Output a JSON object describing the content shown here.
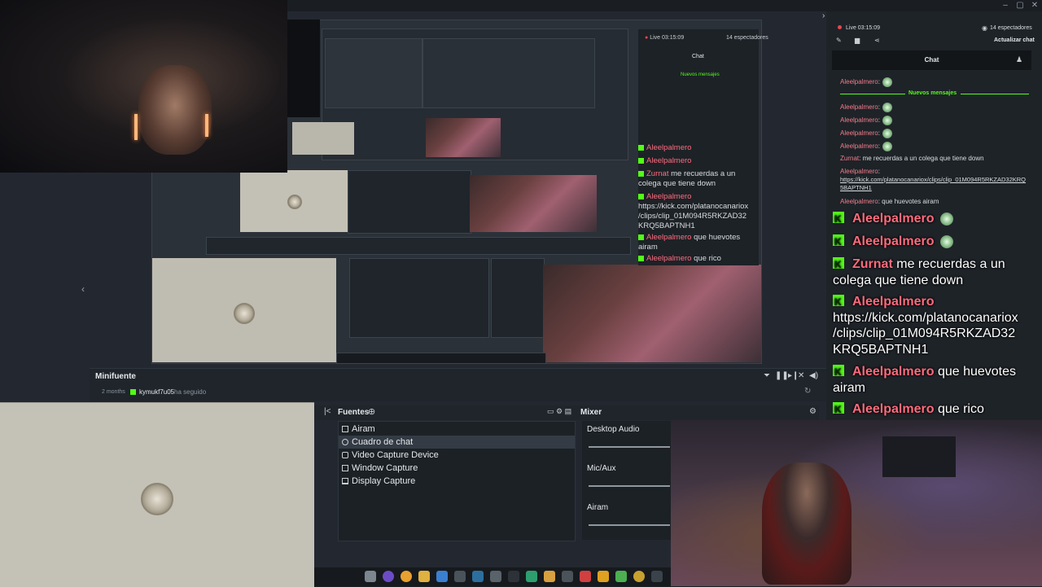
{
  "stream": {
    "live_label": "Live 03:15:09",
    "viewers_label": "14 espectadores",
    "update_chat_label": "Actualizar chat",
    "chat_title": "Chat",
    "new_messages_label": "Nuevos mensajes"
  },
  "chat_small": [
    {
      "user": "Aleelpalmero",
      "text": ":",
      "emote": true
    },
    {
      "user": "Aleelpalmero",
      "text": ":",
      "emote": true
    },
    {
      "user": "Aleelpalmero",
      "text": ":",
      "emote": true
    },
    {
      "user": "Aleelpalmero",
      "text": ":",
      "emote": true
    },
    {
      "user": "Aleelpalmero",
      "text": ":",
      "emote": true
    },
    {
      "user": "Zurnat",
      "text": ": me recuerdas a un colega que tiene down",
      "emote": false
    },
    {
      "user": "Aleelpalmero",
      "text": ":",
      "emote": false
    },
    {
      "user": "",
      "text": "https://kick.com/platanocanariox/clips/clip_01M094R5RKZAD32KRQ",
      "emote": false
    },
    {
      "user": "",
      "text": "5BAPTNH1",
      "emote": false
    },
    {
      "user": "Aleelpalmero",
      "text": ": que huevotes airam",
      "emote": false
    }
  ],
  "chat_big": {
    "line1_user": "Aleelpalmero",
    "line2_user": "Aleelpalmero",
    "line3_user": "Zurnat",
    "line3_text": "me recuerdas a un",
    "line3b_text": "colega que tiene down",
    "line4_user": "Aleelpalmero",
    "line5_text": "https://kick.com/platanocanariox",
    "line6_text": "/clips/clip_01M094R5RKZAD32",
    "line7_text": "KRQ5BAPTNH1",
    "line8_user": "Aleelpalmero",
    "line8_text": "que huevotes",
    "line8b_text": "airam",
    "line9_user": "Aleelpalmero",
    "line9_text": "que rico"
  },
  "mini_chat": {
    "l1_user": "Aleelpalmero",
    "l2_user": "Aleelpalmero",
    "l3_user": "Zurnat",
    "l3_text": "me recuerdas a un",
    "l3b_text": "colega que tiene down",
    "l4_user": "Aleelpalmero",
    "l5_text": "https://kick.com/platanocanariox",
    "l6_text": "/clips/clip_01M094R5RKZAD32",
    "l7_text": "KRQ5BAPTNH1",
    "l8_user": "Aleelpalmero",
    "l8_text": "que huevotes",
    "l8b_text": "airam",
    "l9_user": "Aleelpalmero",
    "l9_text": "que rico",
    "live_label": "Live 03:15:09",
    "viewers_label": "14 espectadores",
    "chat_title": "Chat",
    "new_messages_label": "Nuevos mensajes"
  },
  "minifuente": {
    "title": "Minifuente",
    "time_ago": "2 months",
    "follower": "kymukf7u05",
    "action": "ha seguido"
  },
  "sources": {
    "title": "Fuentes",
    "items": [
      "Airam",
      "Cuadro de chat",
      "Video Capture Device",
      "Window Capture",
      "Display Capture"
    ],
    "selected_index": 1
  },
  "mixer": {
    "title": "Mixer",
    "channels": [
      "Desktop Audio",
      "Mic/Aux",
      "Airam"
    ]
  },
  "colors": {
    "kick_green": "#53fc18",
    "username_pink": "#ff6b7d",
    "live_red": "#e5484d"
  },
  "icons": {
    "prev": "chevron-left-icon",
    "next": "chevron-right-icon",
    "settings": "gear-icon",
    "add": "plus-icon",
    "filter": "filter-icon",
    "pause": "pause-icon",
    "skip": "skip-icon",
    "volume": "volume-icon",
    "refresh": "refresh-icon"
  }
}
